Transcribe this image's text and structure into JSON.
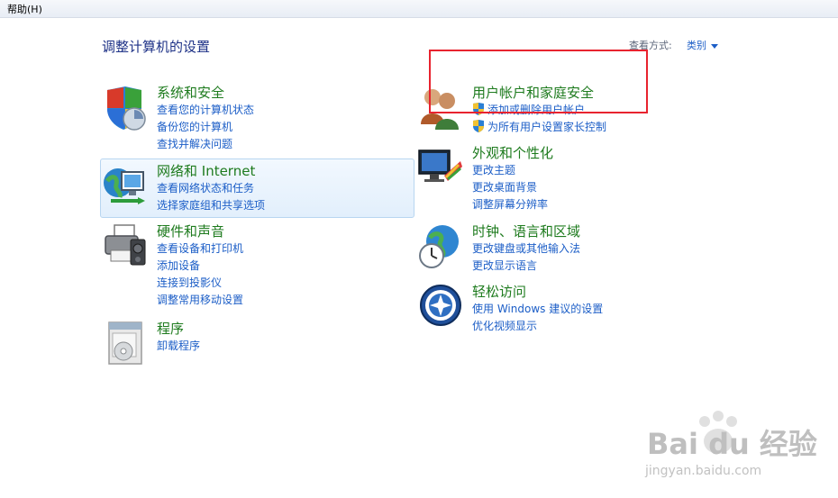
{
  "menubar": {
    "help": "帮助(H)"
  },
  "page_title": "调整计算机的设置",
  "view": {
    "label": "查看方式:",
    "value": "类别"
  },
  "categories": {
    "system": {
      "title": "系统和安全",
      "links": [
        "查看您的计算机状态",
        "备份您的计算机",
        "查找并解决问题"
      ],
      "icon": "shield-icon"
    },
    "network": {
      "title": "网络和 Internet",
      "links": [
        "查看网络状态和任务",
        "选择家庭组和共享选项"
      ],
      "icon": "network-globe-icon"
    },
    "hardware": {
      "title": "硬件和声音",
      "links": [
        "查看设备和打印机",
        "添加设备",
        "连接到投影仪",
        "调整常用移动设置"
      ],
      "icon": "printer-icon"
    },
    "programs": {
      "title": "程序",
      "links": [
        "卸载程序"
      ],
      "icon": "programs-icon"
    },
    "users": {
      "title": "用户帐户和家庭安全",
      "links": [
        "添加或删除用户帐户",
        "为所有用户设置家长控制"
      ],
      "icon": "users-icon"
    },
    "appearance": {
      "title": "外观和个性化",
      "links": [
        "更改主题",
        "更改桌面背景",
        "调整屏幕分辨率"
      ],
      "icon": "monitor-icon"
    },
    "clock": {
      "title": "时钟、语言和区域",
      "links": [
        "更改键盘或其他输入法",
        "更改显示语言"
      ],
      "icon": "clock-globe-icon"
    },
    "access": {
      "title": "轻松访问",
      "links": [
        "使用 Windows 建议的设置",
        "优化视频显示"
      ],
      "icon": "ease-of-access-icon"
    }
  },
  "colors": {
    "title_green": "#1e7b1e",
    "link_blue": "#1c5ec7",
    "highlight_red": "#e8232f"
  },
  "watermark": {
    "brand": "Bai du 经验",
    "url": "jingyan.baidu.com"
  }
}
